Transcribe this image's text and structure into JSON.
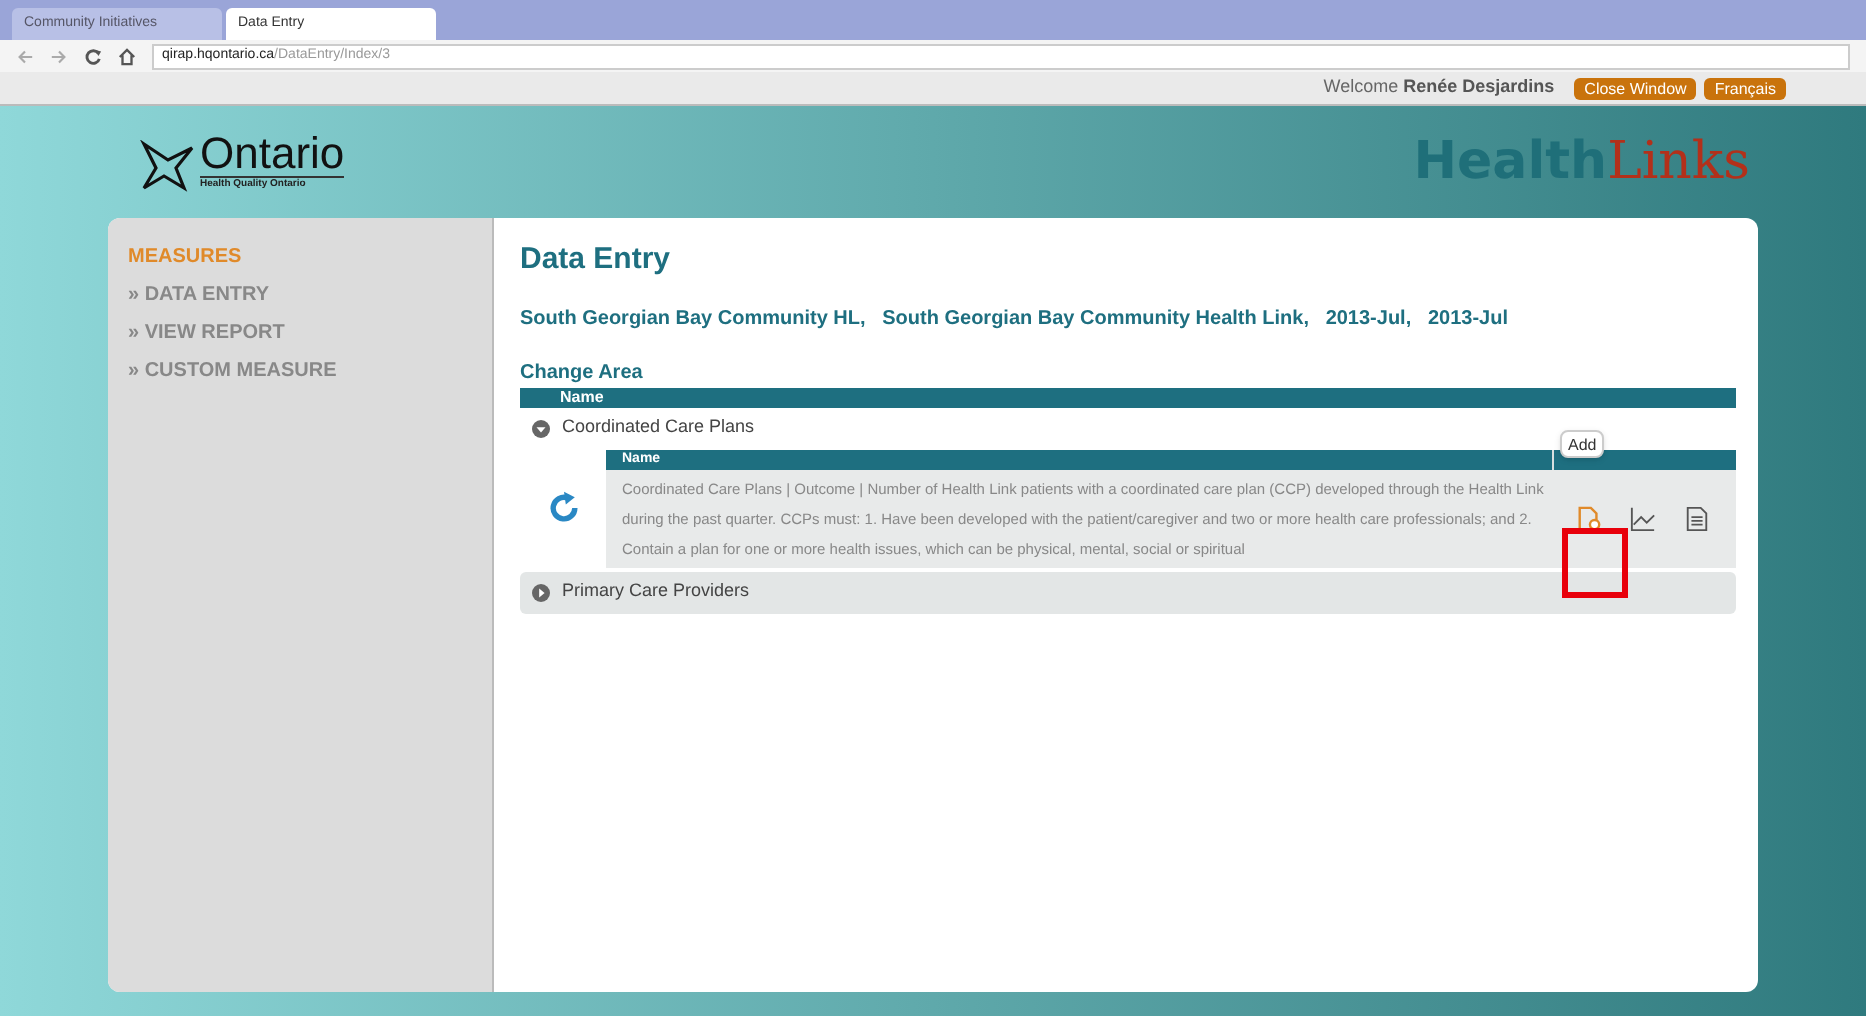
{
  "browser": {
    "tabs": [
      {
        "label": "Community Initiatives",
        "selected": false
      },
      {
        "label": "Data Entry",
        "selected": true
      }
    ],
    "url_host": "qirap.hqontario.ca",
    "url_path": "/DataEntry/Index/3"
  },
  "top_bar": {
    "welcome": "Welcome",
    "user": "Renée Desjardins",
    "buttons": [
      "Close Window",
      "Français"
    ]
  },
  "header": {
    "logo_name": "Ontario",
    "logo_subtitle": "Health Quality Ontario",
    "brand_first": "Health",
    "brand_second": "Links"
  },
  "sidebar": {
    "heading": "MEASURES",
    "items": [
      "» DATA ENTRY",
      "» VIEW REPORT",
      "» CUSTOM MEASURE"
    ]
  },
  "main": {
    "title": "Data Entry",
    "context": "South Georgian Bay Community HL,   South Georgian Bay Community Health Link,   2013-Jul,   2013-Jul",
    "change_area": "Change Area",
    "column": "Name",
    "groups": [
      {
        "label": "Coordinated Care Plans",
        "expanded": true,
        "column": "Name",
        "rows": [
          {
            "description": "Coordinated Care Plans | Outcome | Number of Health Link patients with a coordinated care plan (CCP) developed through the Health Link during the past quarter. CCPs must: 1. Have been developed with the patient/caregiver and two or more health care professionals; and 2. Contain a plan for one or more health issues, which can be physical, mental, social or spiritual",
            "tooltip": "Add"
          }
        ]
      },
      {
        "label": "Primary Care Providers",
        "expanded": false
      }
    ]
  }
}
